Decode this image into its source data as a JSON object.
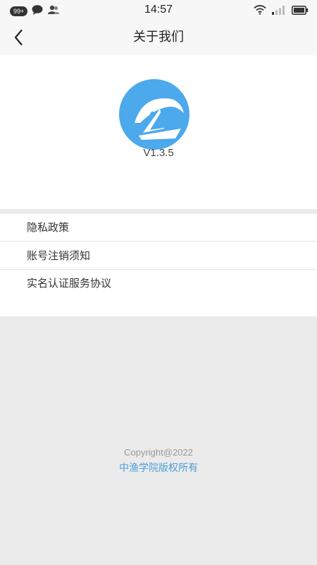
{
  "status_bar": {
    "notification_count": "99+",
    "time": "14:57"
  },
  "header": {
    "title": "关于我们",
    "back_icon": "chevron-left-icon"
  },
  "about": {
    "logo_icon": "sailboat-logo",
    "version": "V1.3.5"
  },
  "menu": {
    "items": [
      {
        "label": "隐私政策"
      },
      {
        "label": "账号注销须知"
      },
      {
        "label": "实名认证服务协议"
      }
    ]
  },
  "footer": {
    "copyright": "Copyright@2022",
    "owner": "中渔学院版权所有"
  },
  "colors": {
    "brand": "#4ca9ec",
    "link": "#4a9fd8",
    "background": "#ebebeb"
  }
}
